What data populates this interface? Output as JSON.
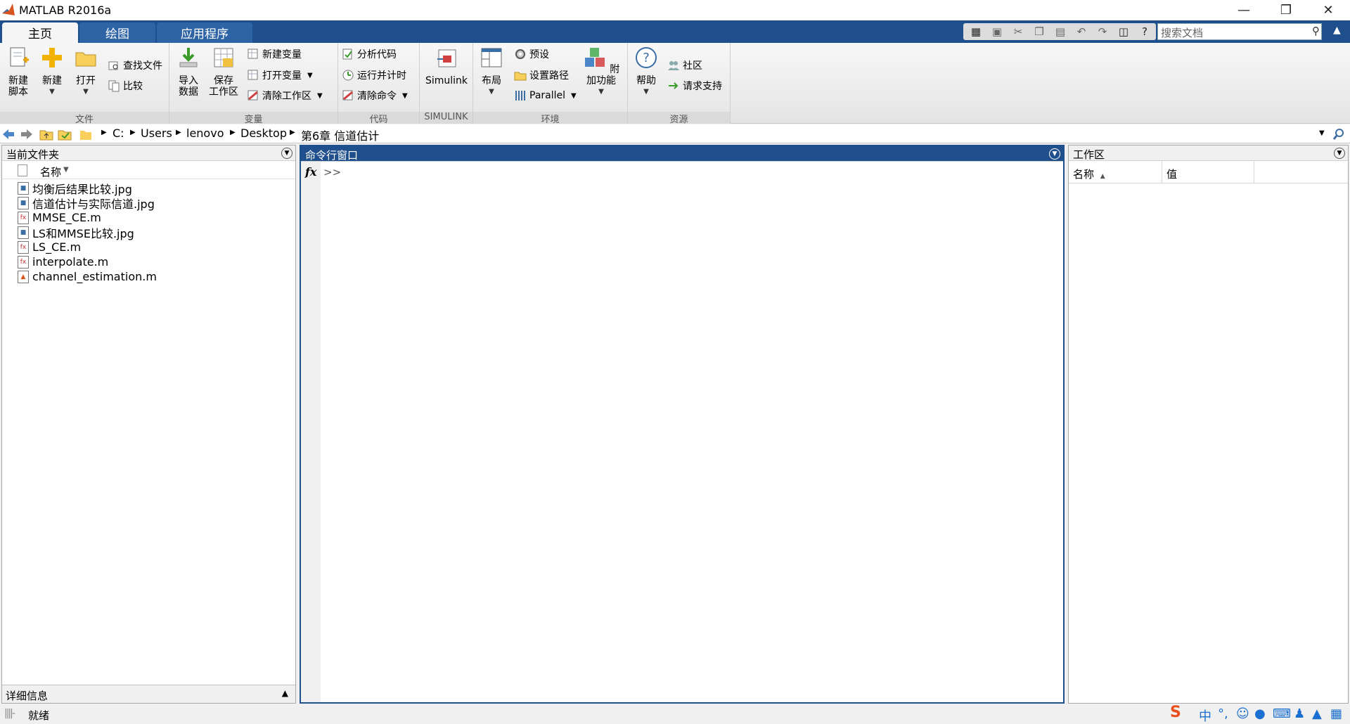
{
  "window": {
    "title": "MATLAB R2016a"
  },
  "tabs": [
    {
      "label": "主页",
      "active": true
    },
    {
      "label": "绘图",
      "active": false
    },
    {
      "label": "应用程序",
      "active": false
    }
  ],
  "search": {
    "placeholder": "搜索文档"
  },
  "ribbon": {
    "file": {
      "label": "文件",
      "new_script": "新建\n脚本",
      "new": "新建",
      "open": "打开",
      "find_files": "查找文件",
      "compare": "比较"
    },
    "variable": {
      "label": "变量",
      "import_data": "导入\n数据",
      "save_workspace": "保存\n工作区",
      "new_variable": "新建变量",
      "open_variable": "打开变量",
      "clear_workspace": "清除工作区"
    },
    "code": {
      "label": "代码",
      "analyze_code": "分析代码",
      "run_and_time": "运行并计时",
      "clear_commands": "清除命令"
    },
    "simulink": {
      "label": "SIMULINK",
      "simulink": "Simulink"
    },
    "environment": {
      "label": "环境",
      "layout": "布局",
      "preferences": "预设",
      "set_path": "设置路径",
      "parallel": "Parallel",
      "addons": "附加功能"
    },
    "resources": {
      "label": "资源",
      "help": "帮助",
      "community": "社区",
      "request_support": "请求支持"
    }
  },
  "address": {
    "parts": [
      "C:",
      "Users",
      "lenovo",
      "Desktop",
      "第6章 信道估计"
    ]
  },
  "current_folder": {
    "title": "当前文件夹",
    "column_name": "名称",
    "files": [
      {
        "name": "均衡后结果比较.jpg",
        "kind": "image"
      },
      {
        "name": "信道估计与实际信道.jpg",
        "kind": "image"
      },
      {
        "name": "MMSE_CE.m",
        "kind": "function"
      },
      {
        "name": "LS和MMSE比较.jpg",
        "kind": "image"
      },
      {
        "name": "LS_CE.m",
        "kind": "function"
      },
      {
        "name": "interpolate.m",
        "kind": "function"
      },
      {
        "name": "channel_estimation.m",
        "kind": "script"
      }
    ],
    "details": "详细信息"
  },
  "command_window": {
    "title": "命令行窗口",
    "fx": "fx",
    "prompt": ">>"
  },
  "workspace": {
    "title": "工作区",
    "col_name": "名称",
    "col_value": "值"
  },
  "status": {
    "text": "就绪"
  },
  "colors": {
    "accent": "#1f4f8c",
    "tab": "#2e64a6"
  }
}
